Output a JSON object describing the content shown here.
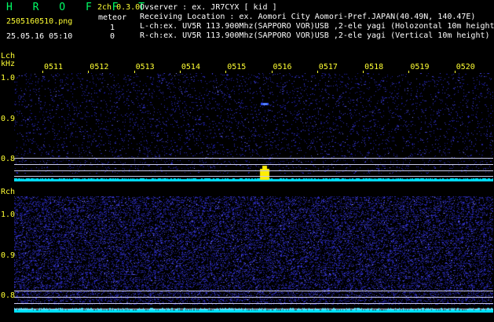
{
  "header": {
    "app_title": "H R O F F T",
    "version": "2ch 0.3.0",
    "filename": "2505160510.png",
    "meteor_label": "meteor",
    "lch_count": "1",
    "rch_count": "0",
    "timestamp": "25.05.16 05:10"
  },
  "info": {
    "observer": "Ovserver             : ex. JR7CYX [ kid ]",
    "location": "Receiving Location : ex. Aomori City Aomori-Pref.JAPAN(40.49N, 140.47E)",
    "lch": "L-ch:ex. UV5R 113.900Mhz(SAPPORO VOR)USB ,2-ele yagi (Holozontal 10m height)",
    "rch": "R-ch:ex. UV5R 113.900Mhz(SAPPORO VOR)USB ,2-ele yagi (Vertical 10m height)"
  },
  "axes": {
    "lch_label": "Lch",
    "khz_label": "kHz",
    "rch_label": "Rch",
    "time_ticks": [
      "0511",
      "0512",
      "0513",
      "0514",
      "0515",
      "0516",
      "0517",
      "0518",
      "0519",
      "0520"
    ],
    "freq_ticks": [
      "1.0",
      "0.9",
      "0.8"
    ]
  },
  "colors": {
    "background": "#000000",
    "title_green": "#00ff66",
    "label_yellow": "#ffff33",
    "noise_blue": "#1a1aa6",
    "meteor_yellow": "#ffee00",
    "level_cyan": "#00e5ff"
  }
}
